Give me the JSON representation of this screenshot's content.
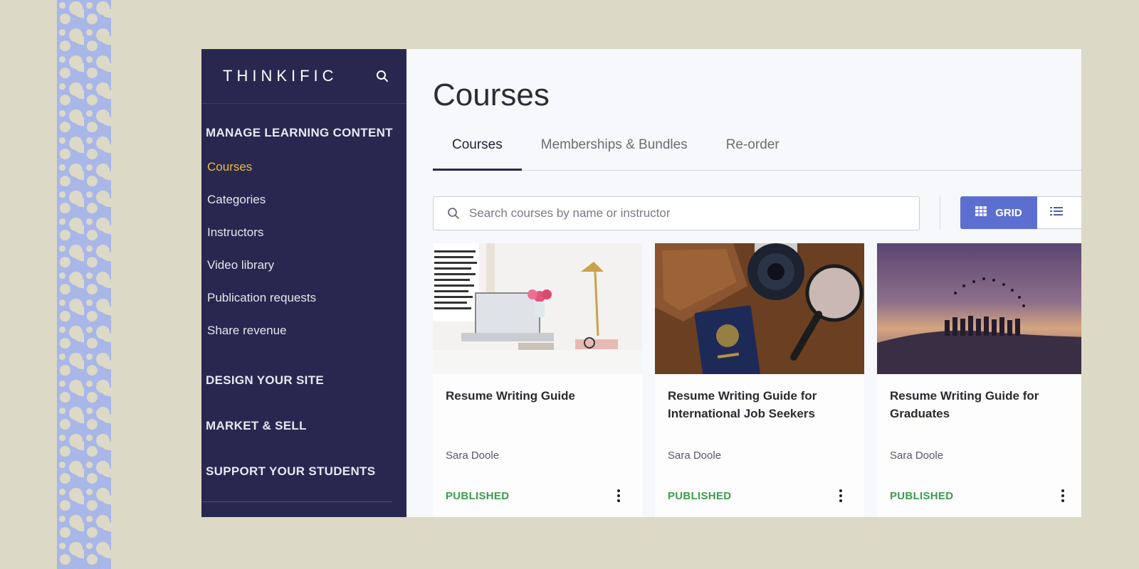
{
  "sidebar": {
    "brand": "THINKIFIC",
    "sections": {
      "manage": "MANAGE LEARNING CONTENT",
      "design": "DESIGN YOUR SITE",
      "market": "MARKET & SELL",
      "support": "SUPPORT YOUR STUDENTS"
    },
    "items": [
      {
        "label": "Courses",
        "active": true
      },
      {
        "label": "Categories"
      },
      {
        "label": "Instructors"
      },
      {
        "label": "Video library"
      },
      {
        "label": "Publication requests"
      },
      {
        "label": "Share revenue"
      }
    ]
  },
  "main": {
    "title": "Courses",
    "tabs": [
      {
        "label": "Courses",
        "active": true
      },
      {
        "label": "Memberships & Bundles"
      },
      {
        "label": "Re-order"
      }
    ],
    "search": {
      "placeholder": "Search courses by name or instructor",
      "icon": "search-icon"
    },
    "view_toggle": {
      "grid_label": "GRID",
      "grid_icon": "grid-icon",
      "list_icon": "list-icon"
    },
    "cards": [
      {
        "title": "Resume Writing Guide",
        "author": "Sara Doole",
        "status": "PUBLISHED"
      },
      {
        "title": "Resume Writing Guide for International Job Seekers",
        "author": "Sara Doole",
        "status": "PUBLISHED"
      },
      {
        "title": "Resume Writing Guide for Graduates",
        "author": "Sara Doole",
        "status": "PUBLISHED"
      }
    ]
  },
  "colors": {
    "sidebar_bg": "#27274f",
    "active_item": "#f4b942",
    "accent": "#5c6fd1",
    "published": "#3c9b4c",
    "background": "#dcd9c6"
  }
}
